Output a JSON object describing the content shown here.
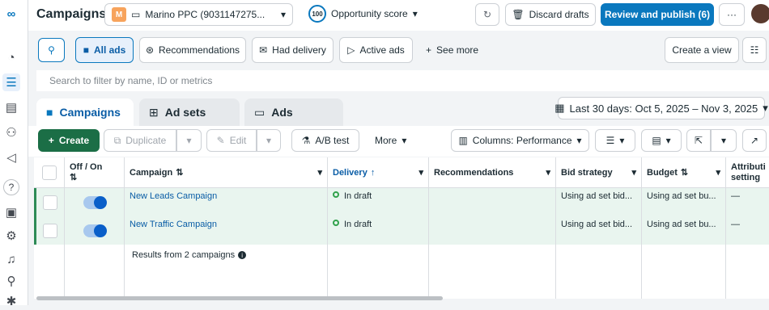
{
  "header": {
    "title": "Campaigns",
    "account_badge": "M",
    "account_name": "Marino PPC (9031147275...",
    "opportunity_score": "100",
    "opportunity_label": "Opportunity score",
    "discard": "Discard drafts",
    "review": "Review and publish (6)",
    "more": "···"
  },
  "filters": {
    "all_ads": "All ads",
    "recommendations": "Recommendations",
    "had_delivery": "Had delivery",
    "active_ads": "Active ads",
    "see_more": "See more",
    "create_view": "Create a view"
  },
  "search": {
    "placeholder": "Search to filter by name, ID or metrics"
  },
  "tabs": [
    {
      "label": "Campaigns"
    },
    {
      "label": "Ad sets"
    },
    {
      "label": "Ads"
    }
  ],
  "date_range": "Last 30 days: Oct 5, 2025 – Nov 3, 2025",
  "toolbar": {
    "create": "Create",
    "duplicate": "Duplicate",
    "edit": "Edit",
    "ab_test": "A/B test",
    "more": "More",
    "columns": "Columns: Performance"
  },
  "table": {
    "headers": {
      "off_on": "Off / On",
      "campaign": "Campaign",
      "delivery": "Delivery",
      "recommendations": "Recommendations",
      "bid_strategy": "Bid strategy",
      "budget": "Budget",
      "attribution": "Attributi setting"
    },
    "rows": [
      {
        "name": "New Leads Campaign",
        "delivery": "In draft",
        "bid": "Using ad set bid...",
        "budget": "Using ad set bu...",
        "attribution": "—"
      },
      {
        "name": "New Traffic Campaign",
        "delivery": "In draft",
        "bid": "Using ad set bid...",
        "budget": "Using ad set bu...",
        "attribution": "—"
      }
    ],
    "footer": "Results from 2 campaigns"
  },
  "colors": {
    "primary": "#0a78be",
    "create": "#1b6e46"
  }
}
